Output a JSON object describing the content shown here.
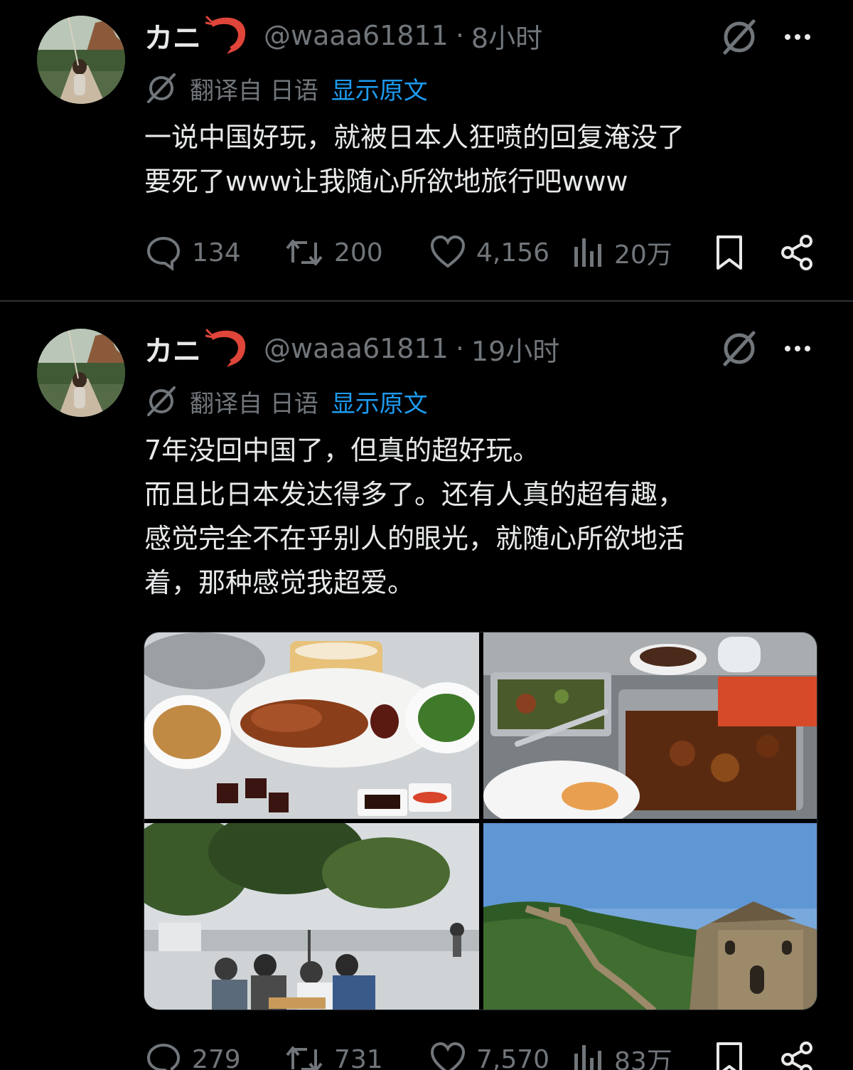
{
  "posts": [
    {
      "display_name": "カニ",
      "handle": "@waaa61811",
      "separator": "·",
      "time": "8小时",
      "translated_label": "翻译自 日语",
      "show_original": "显示原文",
      "text_lines": [
        "一说中国好玩，就被日本人狂喷的回复淹没了",
        "要死了www让我随心所欲地旅行吧www"
      ],
      "stats": {
        "replies": "134",
        "reposts": "200",
        "likes": "4,156",
        "views": "20万"
      },
      "icons": [
        "reply-icon",
        "retweet-icon",
        "heart-icon",
        "views-icon",
        "bookmark-icon",
        "share-icon",
        "grok-icon",
        "more-icon",
        "translate-icon"
      ]
    },
    {
      "display_name": "カニ",
      "handle": "@waaa61811",
      "separator": "·",
      "time": "19小时",
      "translated_label": "翻译自 日语",
      "show_original": "显示原文",
      "text_lines": [
        "7年没回中国了，但真的超好玩。",
        "而且比日本发达得多了。还有人真的超有趣，",
        "感觉完全不在乎别人的眼光，就随心所欲地活",
        "着，那种感觉我超爱。"
      ],
      "media": [
        "food-photo-roast-duck",
        "food-photo-buffet",
        "street-photo-card-game",
        "great-wall-photo"
      ],
      "stats": {
        "replies": "279",
        "reposts": "731",
        "likes": "7,570",
        "views": "83万"
      }
    }
  ],
  "colors": {
    "background": "#000000",
    "text": "#e7e9ea",
    "muted": "#71767b",
    "link": "#1d9bf0",
    "divider": "#2f3336",
    "shrimp": "#e0453a"
  }
}
